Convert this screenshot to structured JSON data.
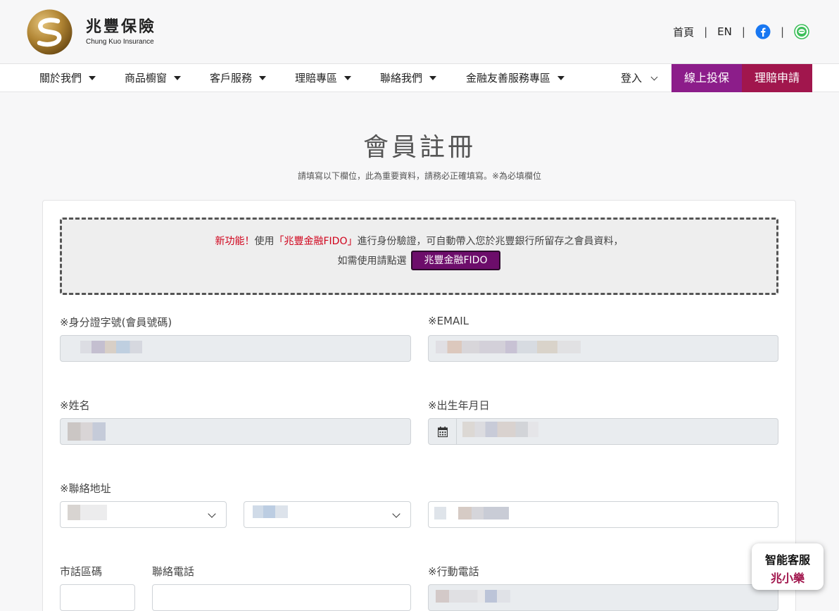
{
  "header": {
    "brand_cn": "兆豐保險",
    "brand_en": "Chung Kuo Insurance",
    "links": {
      "home": "首頁",
      "lang": "EN",
      "sep": "|"
    }
  },
  "nav": {
    "items": [
      "關於我們",
      "商品櫥窗",
      "客戶服務",
      "理賠專區",
      "聯絡我們",
      "金融友善服務專區"
    ],
    "login": "登入",
    "buy_online": "線上投保",
    "claim_apply": "理賠申請"
  },
  "page": {
    "title": "會員註冊",
    "subtitle": "請填寫以下欄位，此為重要資料，請務必正確填寫。※為必填欄位"
  },
  "fido": {
    "new_feature": "新功能！",
    "text_a": "使用",
    "fido_name": "「兆豐金融FIDO」",
    "text_b": "進行身份驗證，可自動帶入您於兆豐銀行所留存之會員資料，",
    "line2": "如需使用請點選",
    "button": "兆豐金融FIDO"
  },
  "form": {
    "id_label": "※身分證字號(會員號碼)",
    "email_label": "※EMAIL",
    "name_label": "※姓名",
    "birth_label": "※出生年月日",
    "address_label": "※聯絡地址",
    "area_code_label": "市話區碼",
    "phone_label": "聯絡電話",
    "mobile_label": "※行動電話"
  },
  "chat": {
    "line1": "智能客服",
    "line2": "兆小樂"
  },
  "colors": {
    "purple": "#8c1d8a",
    "crimson": "#a1164d",
    "red": "#d0021b"
  }
}
